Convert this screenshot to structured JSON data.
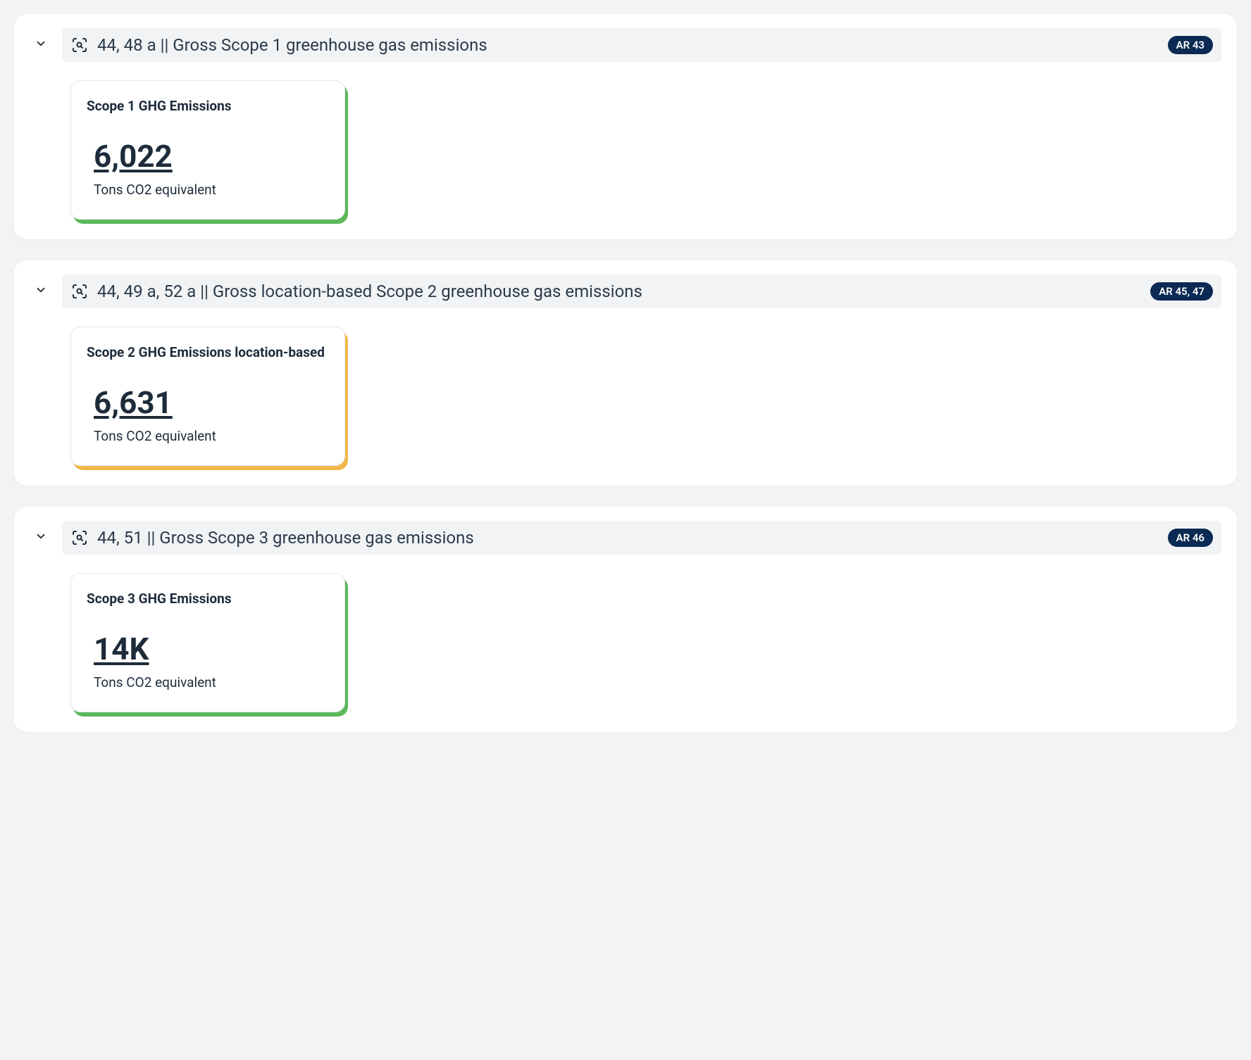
{
  "sections": [
    {
      "code": "44, 48 a",
      "title": "Gross Scope 1 greenhouse gas emissions",
      "header_label": "44, 48 a || Gross Scope 1 greenhouse gas emissions",
      "badge": "AR 43",
      "card": {
        "title": "Scope 1 GHG Emissions",
        "value": "6,022",
        "unit": "Tons CO2 equivalent",
        "accent": "green"
      }
    },
    {
      "code": "44, 49 a, 52 a",
      "title": "Gross location-based Scope 2 greenhouse gas emissions",
      "header_label": "44, 49 a, 52 a || Gross location-based Scope 2 greenhouse gas emissions",
      "badge": "AR 45, 47",
      "card": {
        "title": "Scope 2 GHG Emissions location-based",
        "value": "6,631",
        "unit": "Tons CO2 equivalent",
        "accent": "yellow"
      }
    },
    {
      "code": "44, 51",
      "title": "Gross Scope 3 greenhouse gas emissions",
      "header_label": "44, 51 || Gross Scope 3 greenhouse gas emissions",
      "badge": "AR 46",
      "card": {
        "title": "Scope 3 GHG Emissions",
        "value": "14K",
        "unit": "Tons CO2 equivalent",
        "accent": "green"
      }
    }
  ]
}
